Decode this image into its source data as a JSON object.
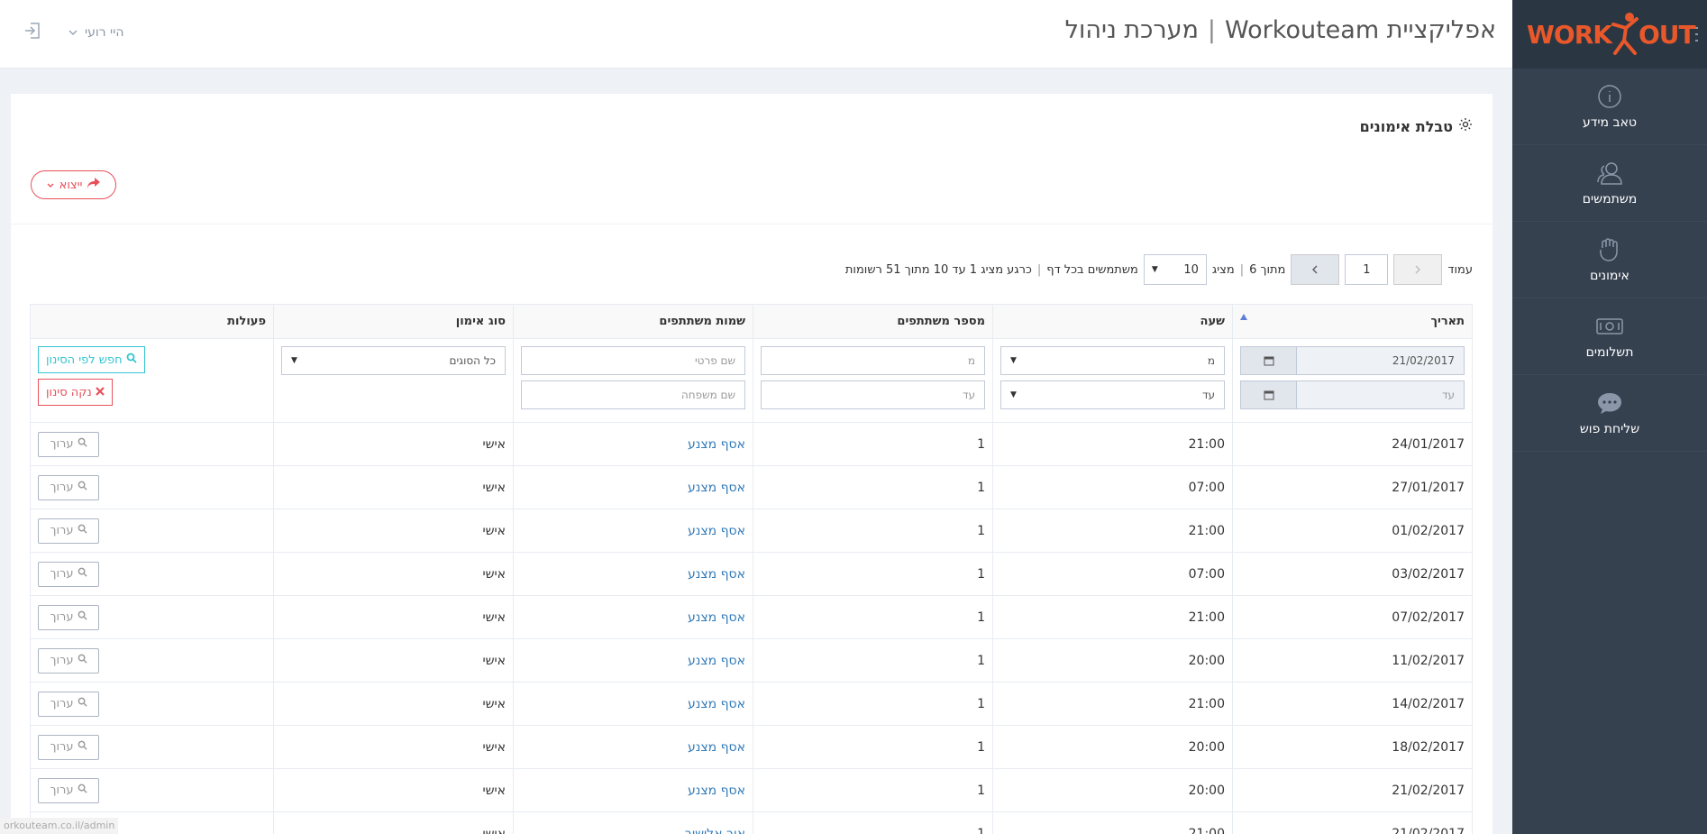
{
  "header": {
    "app_name": "אפליקציית Workouteam",
    "separator": "|",
    "section": "מערכת ניהול",
    "user_greeting": "היי רועי"
  },
  "logo": {
    "left": "WORK",
    "right": "OUT"
  },
  "sidebar": {
    "items": [
      {
        "label": "טאב מידע",
        "icon": "info-icon"
      },
      {
        "label": "משתמשים",
        "icon": "users-icon"
      },
      {
        "label": "אימונים",
        "icon": "hand-icon"
      },
      {
        "label": "תשלומים",
        "icon": "money-icon"
      },
      {
        "label": "שליחת פוש",
        "icon": "chat-icon"
      }
    ]
  },
  "portlet": {
    "title": "טבלת אימונים",
    "export_label": "ייצוא"
  },
  "pager": {
    "page_label": "עמוד",
    "page_value": "1",
    "of_label": "מתוך 6",
    "show_label": "מציג",
    "per_page_value": "10",
    "per_page_label": "משתמשים בכל דף",
    "summary": "כרגע מציג 1 עד 10 מתוך 51 רשומות"
  },
  "table": {
    "headers": [
      "תאריך",
      "שעה",
      "מספר משתתפים",
      "שמות משתתפים",
      "סוג אימון",
      "פעולות"
    ],
    "filters": {
      "date_from": "21/02/2017",
      "date_to_placeholder": "עד",
      "time_from": "מ",
      "time_to": "עד",
      "count_from": "מ",
      "count_to": "עד",
      "first_name_placeholder": "שם פרטי",
      "last_name_placeholder": "שם משפחה",
      "type_select": "כל הסוגים",
      "search_label": "חפש לפי הסינון",
      "clear_label": "נקה סינון"
    },
    "edit_label": "ערוך",
    "rows": [
      {
        "date": "24/01/2017",
        "time": "21:00",
        "count": "1",
        "names": "אסף מצנע",
        "type": "אישי"
      },
      {
        "date": "27/01/2017",
        "time": "07:00",
        "count": "1",
        "names": "אסף מצנע",
        "type": "אישי"
      },
      {
        "date": "01/02/2017",
        "time": "21:00",
        "count": "1",
        "names": "אסף מצנע",
        "type": "אישי"
      },
      {
        "date": "03/02/2017",
        "time": "07:00",
        "count": "1",
        "names": "אסף מצנע",
        "type": "אישי"
      },
      {
        "date": "07/02/2017",
        "time": "21:00",
        "count": "1",
        "names": "אסף מצנע",
        "type": "אישי"
      },
      {
        "date": "11/02/2017",
        "time": "20:00",
        "count": "1",
        "names": "אסף מצנע",
        "type": "אישי"
      },
      {
        "date": "14/02/2017",
        "time": "21:00",
        "count": "1",
        "names": "אסף מצנע",
        "type": "אישי"
      },
      {
        "date": "18/02/2017",
        "time": "20:00",
        "count": "1",
        "names": "אסף מצנע",
        "type": "אישי"
      },
      {
        "date": "21/02/2017",
        "time": "20:00",
        "count": "1",
        "names": "אסף מצנע",
        "type": "אישי"
      },
      {
        "date": "21/02/2017",
        "time": "21:00",
        "count": "1",
        "names": "אור אלישיב",
        "type": "אישי"
      }
    ]
  },
  "status_url": "orkouteam.co.il/admin",
  "colors": {
    "sidebar": "#364150",
    "accent": "#e8582a",
    "danger": "#e7505a",
    "info": "#32c5d2",
    "link": "#337ab7"
  }
}
